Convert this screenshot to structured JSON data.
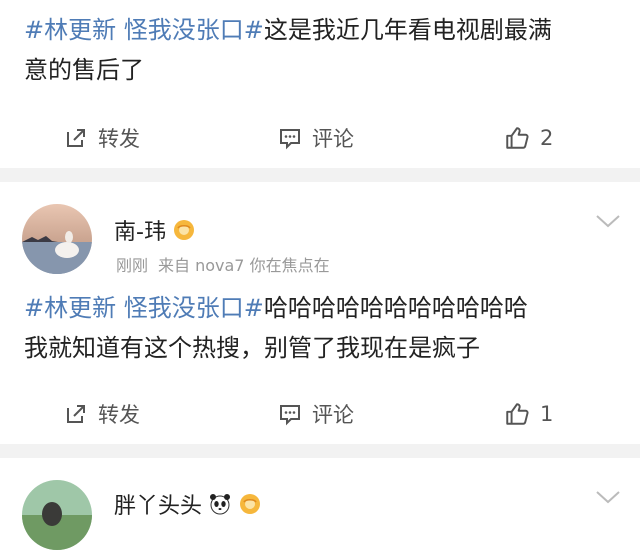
{
  "posts": [
    {
      "tag": "#林更新 怪我没张口#",
      "text_line1": "这是我近几年看电视剧最满",
      "text_line2": "意的售后了",
      "repost_label": "转发",
      "comment_label": "评论",
      "like_count": "2"
    },
    {
      "username": "南-玮",
      "time": "刚刚",
      "source": "来自 nova7 你在焦点在",
      "tag": "#林更新 怪我没张口#",
      "text_line1": "哈哈哈哈哈哈哈哈哈哈哈",
      "text_line2": "我就知道有这个热搜，别管了我现在是疯子",
      "repost_label": "转发",
      "comment_label": "评论",
      "like_count": "1"
    },
    {
      "username": "胖丫头头"
    }
  ],
  "colors": {
    "tag": "#4f7cb6",
    "separator": "#f2f2f2",
    "meta": "#999999"
  },
  "icons": [
    "repost-icon",
    "comment-icon",
    "like-icon",
    "badge-icon",
    "panda-icon",
    "chevron-down-icon"
  ]
}
